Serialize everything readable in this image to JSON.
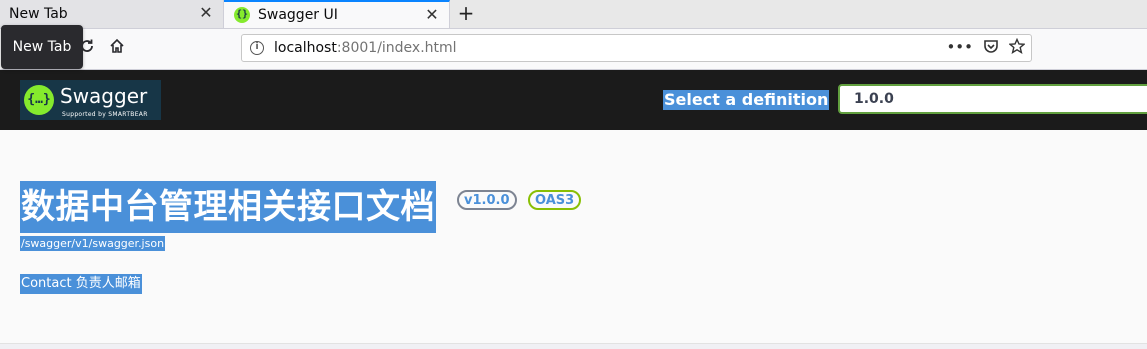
{
  "browser": {
    "tabs": [
      {
        "label": "New Tab",
        "close": "✕"
      },
      {
        "label": "Swagger UI",
        "close": "✕",
        "favicon": "{}"
      }
    ],
    "new_tab_symbol": "+",
    "tooltip": "New Tab",
    "url": {
      "host": "localhost",
      "rest": ":8001/index.html"
    },
    "nav_icons": [
      "reload-icon",
      "home-icon"
    ],
    "url_actions": [
      "more-icon",
      "pocket-icon",
      "bookmark-star-icon"
    ]
  },
  "topbar": {
    "logo_text": "Swagger",
    "logo_sub": "Supported by SMARTBEAR",
    "definition_label": "Select a definition",
    "definition_value": "1.0.0"
  },
  "info": {
    "title": "数据中台管理相关接口文档",
    "version_badge": "v1.0.0",
    "oas_badge": "OAS3",
    "spec_url": "/swagger/v1/swagger.json",
    "contact": "Contact 负责人邮箱"
  },
  "colors": {
    "topbar_bg": "#1b1b1b",
    "selection_highlight": "#4a90d9",
    "swagger_green": "#85ea2d",
    "oas_badge_border": "#89bf04",
    "select_border": "#62a03f"
  }
}
